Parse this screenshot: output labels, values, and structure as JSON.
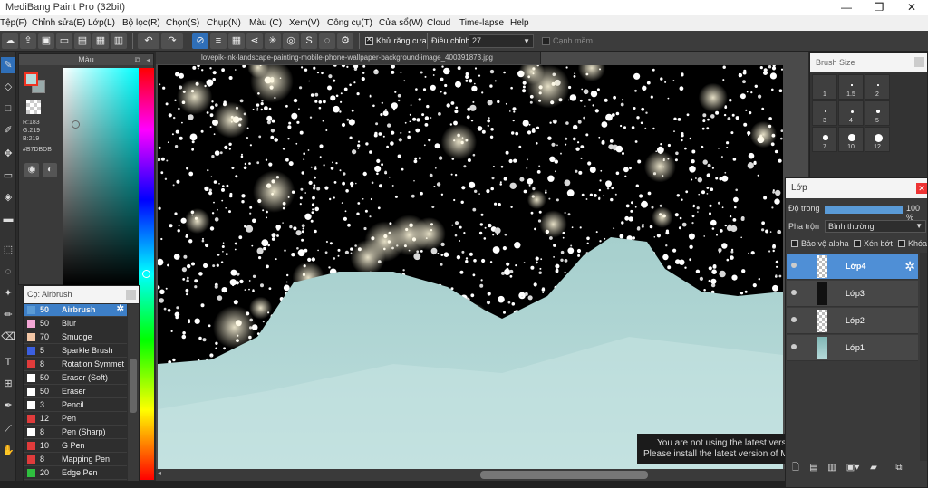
{
  "window": {
    "title": "MediBang Paint Pro (32bit)",
    "minimize": "—",
    "maximize": "❐",
    "close": "✕"
  },
  "menu": [
    "Tệp(F)",
    "Chỉnh sửa(E)",
    "Lớp(L)",
    "Bộ lọc(R)",
    "Chọn(S)",
    "Chụp(N)",
    "Màu (C)",
    "Xem(V)",
    "Công cụ(T)",
    "Cửa sổ(W)",
    "Cloud",
    "Time-lapse",
    "Help"
  ],
  "toolbar": {
    "antialias_label": "Khử răng cưa",
    "antialias_checked": true,
    "stabilizer_label": "Điều chỉnh",
    "stabilizer_value": "27",
    "edge_label": "Cạnh mềm",
    "edge_checked": false,
    "buttons": [
      "cloud-icon",
      "export-icon",
      "save-icon",
      "comment-icon",
      "page-icon",
      "grid-icon",
      "panel-icon",
      "undo-icon",
      "redo-icon",
      "snap-off-icon",
      "snap-parallel-icon",
      "snap-grid-icon",
      "snap-vanish-icon",
      "snap-radial-icon",
      "snap-concentric-icon",
      "snap-curve-icon",
      "snap-ellipse-icon",
      "snap-settings-icon"
    ]
  },
  "color_panel": {
    "title": "Màu",
    "r": "R:183",
    "g": "G:219",
    "b": "B:219",
    "hex": "#B7DBDB",
    "fg_color": "#B7DBDB"
  },
  "brush_panel": {
    "title": "Cọ: Airbrush",
    "brushes": [
      {
        "size": "50",
        "name": "Airbrush",
        "color": "#5b9bd5",
        "selected": true
      },
      {
        "size": "50",
        "name": "Blur",
        "color": "#f3a6d5"
      },
      {
        "size": "70",
        "name": "Smudge",
        "color": "#f3c6a5"
      },
      {
        "size": "5",
        "name": "Sparkle Brush",
        "color": "#3b5fe0"
      },
      {
        "size": "8",
        "name": "Rotation Symmet",
        "color": "#e03b3b"
      },
      {
        "size": "50",
        "name": "Eraser (Soft)",
        "color": "#ffffff"
      },
      {
        "size": "50",
        "name": "Eraser",
        "color": "#ffffff"
      },
      {
        "size": "3",
        "name": "Pencil",
        "color": "#ffffff"
      },
      {
        "size": "12",
        "name": "Pen",
        "color": "#e03b3b"
      },
      {
        "size": "8",
        "name": "Pen (Sharp)",
        "color": "#ffffff"
      },
      {
        "size": "10",
        "name": "G Pen",
        "color": "#e03b3b"
      },
      {
        "size": "8",
        "name": "Mapping Pen",
        "color": "#e03b3b"
      },
      {
        "size": "20",
        "name": "Edge Pen",
        "color": "#2fbf3f"
      }
    ]
  },
  "document": {
    "tab_title": "lovepik-ink-landscape-painting-mobile-phone-wallpaper-background-image_400391873.jpg"
  },
  "notice": {
    "line1": "You are not using the latest vers",
    "line2": "Please install the latest version of M"
  },
  "brush_size_panel": {
    "title": "Brush Size",
    "sizes": [
      "1",
      "1.5",
      "2",
      "3",
      "4",
      "5",
      "7",
      "10",
      "12"
    ]
  },
  "layer_panel": {
    "title": "Lớp",
    "opacity_label": "Độ trong",
    "opacity_value": "100 %",
    "opacity_fraction": 1.0,
    "blend_label": "Pha trộn",
    "blend_value": "Bình thường",
    "protect_alpha": "Bảo vệ alpha",
    "clipping": "Xén bớt",
    "lock": "Khóa",
    "layers": [
      {
        "name": "Lớp4",
        "selected": true,
        "thumb": "blank"
      },
      {
        "name": "Lớp3",
        "selected": false,
        "thumb": "stars"
      },
      {
        "name": "Lớp2",
        "selected": false,
        "thumb": "blank"
      },
      {
        "name": "Lớp1",
        "selected": false,
        "thumb": "land"
      }
    ]
  },
  "colors": {
    "accent": "#2f6fb8",
    "layer_selected": "#4f8fd6",
    "brush_selected": "#3d7fc7",
    "mountain": "#B7DBDB"
  }
}
